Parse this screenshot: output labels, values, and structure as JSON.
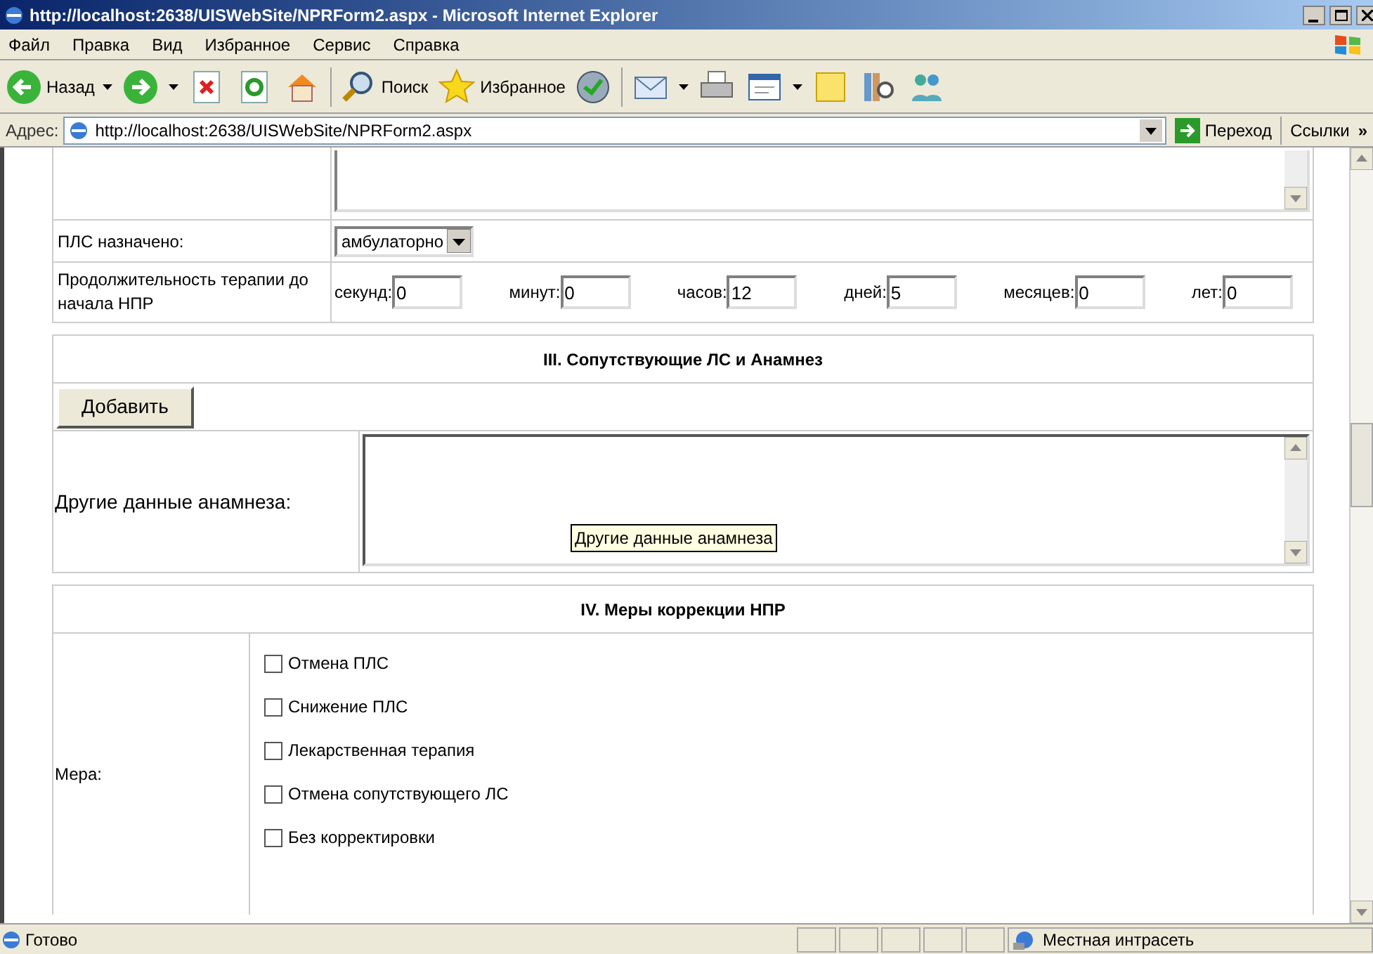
{
  "window": {
    "title": "http://localhost:2638/UISWebSite/NPRForm2.aspx - Microsoft Internet Explorer"
  },
  "menu": [
    "Файл",
    "Правка",
    "Вид",
    "Избранное",
    "Сервис",
    "Справка"
  ],
  "toolbar": {
    "back": "Назад",
    "search": "Поиск",
    "favorites": "Избранное"
  },
  "address_bar": {
    "label": "Адрес:",
    "url": "http://localhost:2638/UISWebSite/NPRForm2.aspx",
    "go": "Переход",
    "links": "Ссылки",
    "more": "»"
  },
  "form": {
    "pls_assigned": {
      "label": "ПЛС назначено:",
      "value": "амбулаторно"
    },
    "duration": {
      "label": "Продолжительность терапии до начала НПР",
      "fields": [
        {
          "label": "секунд:",
          "value": "0"
        },
        {
          "label": "минут:",
          "value": "0"
        },
        {
          "label": "часов:",
          "value": "12"
        },
        {
          "label": "дней:",
          "value": "5"
        },
        {
          "label": "месяцев:",
          "value": "0"
        },
        {
          "label": "лет:",
          "value": "0"
        }
      ]
    },
    "section_3": {
      "title": "III. Сопутствующие ЛС и Анамнез",
      "add_button": "Добавить",
      "anamnesis_label": "Другие данные анамнеза:",
      "tooltip": "Другие данные анамнеза"
    },
    "section_4": {
      "title": "IV. Меры коррекции НПР",
      "measure_label": "Мера:",
      "options": [
        {
          "label": "Отмена ПЛС",
          "checked": false
        },
        {
          "label": "Снижение ПЛС",
          "checked": false
        },
        {
          "label": "Лекарственная терапия",
          "checked": false
        },
        {
          "label": "Отмена сопутствующего ЛС",
          "checked": false
        },
        {
          "label": "Без корректировки",
          "checked": false
        }
      ]
    }
  },
  "status_bar": {
    "text": "Готово",
    "zone": "Местная интрасеть"
  }
}
